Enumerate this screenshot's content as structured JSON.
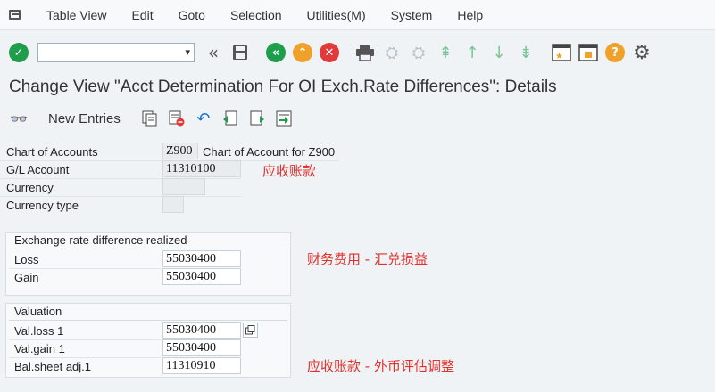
{
  "menu": {
    "items": [
      "Table View",
      "Edit",
      "Goto",
      "Selection",
      "Utilities(M)",
      "System",
      "Help"
    ]
  },
  "toolbar": {
    "command_field_value": ""
  },
  "page": {
    "title": "Change View \"Acct Determination For OI Exch.Rate Differences\": Details"
  },
  "app_toolbar": {
    "new_entries_label": "New Entries"
  },
  "header_fields": {
    "chart_of_accounts_label": "Chart of Accounts",
    "chart_of_accounts_value": "Z900",
    "chart_of_accounts_desc": "Chart of Account for Z900",
    "gl_account_label": "G/L Account",
    "gl_account_value": "11310100",
    "currency_label": "Currency",
    "currency_value": "",
    "currency_type_label": "Currency type",
    "currency_type_value": ""
  },
  "realized_group": {
    "title": "Exchange rate difference realized",
    "loss_label": "Loss",
    "loss_value": "55030400",
    "gain_label": "Gain",
    "gain_value": "55030400"
  },
  "valuation_group": {
    "title": "Valuation",
    "val_loss_label": "Val.loss 1",
    "val_loss_value": "55030400",
    "val_gain_label": "Val.gain 1",
    "val_gain_value": "55030400",
    "bal_sheet_label": "Bal.sheet adj.1",
    "bal_sheet_value": "11310910"
  },
  "annotations": {
    "gl_note": "应收账款",
    "realized_note": "财务费用 - 汇兑损益",
    "valuation_note": "应收账款 - 外币评估调整"
  },
  "colors": {
    "accent_green": "#1e9e4b",
    "accent_orange": "#f0a12a",
    "accent_red": "#e23a3a",
    "annotation_red": "#e0312c"
  }
}
